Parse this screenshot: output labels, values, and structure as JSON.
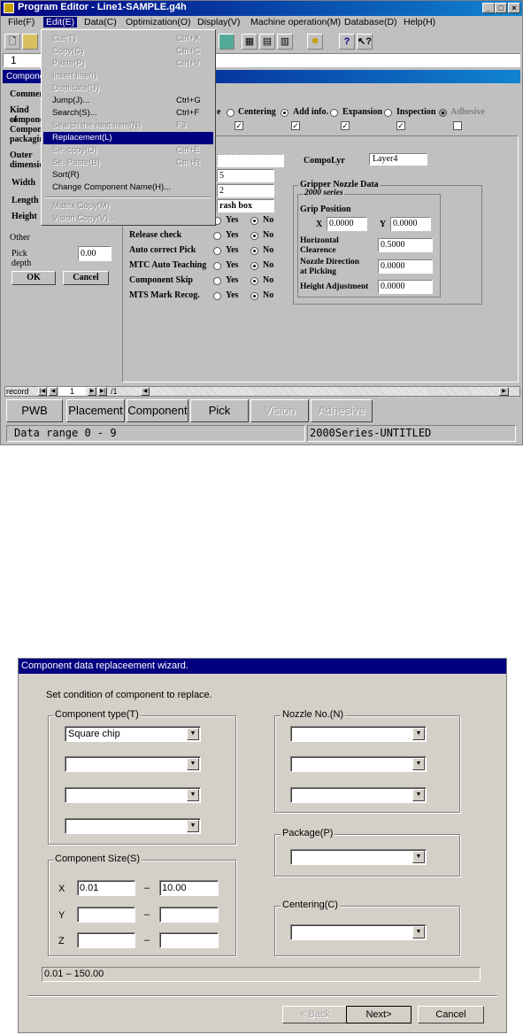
{
  "editor": {
    "title": "Program Editor - Line1-SAMPLE.g4h",
    "menu": [
      "File(F)",
      "Edit(E)",
      "Data(C)",
      "Optimization(O)",
      "Display(V)",
      "Machine operation(M)",
      "Database(D)",
      "Help(H)"
    ],
    "cell_value": "1",
    "panel_title": "Component",
    "edit_menu": [
      {
        "label": "Cut(T)",
        "shortcut": "Ctrl+X",
        "disabled": true
      },
      {
        "label": "Copy(C)",
        "shortcut": "Ctrl+C",
        "disabled": true
      },
      {
        "label": "Paste(P)",
        "shortcut": "Ctrl+V",
        "disabled": true
      },
      {
        "label": "Insert line(I)",
        "shortcut": "",
        "disabled": true
      },
      {
        "label": "Duplicate(U)",
        "shortcut": "",
        "disabled": true
      },
      {
        "label": "Jump(J)...",
        "shortcut": "Ctrl+G",
        "disabled": false
      },
      {
        "label": "Search(S)...",
        "shortcut": "Ctrl+F",
        "disabled": false
      },
      {
        "label": "Search the next item(N)",
        "shortcut": "F3",
        "disabled": true
      },
      {
        "label": "Replacement(L)",
        "shortcut": "",
        "disabled": false,
        "selected": true
      },
      {
        "label": "Se. copy(O)",
        "shortcut": "Ctrl+E",
        "disabled": true
      },
      {
        "label": "Se. Paste(B)",
        "shortcut": "Ctrl+R",
        "disabled": true
      },
      {
        "label": "Sort(R)",
        "shortcut": "",
        "disabled": false
      },
      {
        "label": "Change Component Name(H)...",
        "shortcut": "",
        "disabled": false
      },
      {
        "label": "Matrix Copy(M)",
        "shortcut": "",
        "disabled": true
      },
      {
        "label": "Vision Copy(V)...",
        "shortcut": "",
        "disabled": true
      }
    ],
    "left_labels": {
      "comment": "Commen",
      "kind1": "Kind of",
      "kind2": "compone",
      "kind3": "Compon",
      "kind4": "packagin",
      "outer1": "Outer",
      "outer2": "dimensio",
      "width": "Width",
      "length": "Length",
      "height": "Height",
      "other": "Other",
      "pick_depth": "Pick depth",
      "pick_depth_value": "0.00",
      "ok": "OK",
      "cancel": "Cancel"
    },
    "tabs_top": [
      "e",
      "Centering",
      "Add info.",
      "Expansion",
      "Inspection",
      "Adhesive"
    ],
    "fields": {
      "f1": "5",
      "f2": "2",
      "f3": "rash box"
    },
    "compo_lyr_label": "CompoLyr",
    "compo_lyr_value": "Layer4",
    "options": [
      {
        "label": "",
        "yes": "Yes",
        "no": "No"
      },
      {
        "label": "Release check",
        "yes": "Yes",
        "no": "No"
      },
      {
        "label": "Auto correct Pick",
        "yes": "Yes",
        "no": "No"
      },
      {
        "label": "MTC Auto Teaching",
        "yes": "Yes",
        "no": "No"
      },
      {
        "label": "Component Skip",
        "yes": "Yes",
        "no": "No"
      },
      {
        "label": "MTS Mark Recog.",
        "yes": "Yes",
        "no": "No"
      }
    ],
    "gripper": {
      "title": "Gripper Nozzle Data",
      "series": "2000 series",
      "grip_position": "Grip Position",
      "x_label": "X",
      "x_value": "0.0000",
      "y_label": "Y",
      "y_value": "0.0000",
      "horizontal_1": "Horizontal",
      "horizontal_2": "Clearence",
      "horizontal_value": "0.5000",
      "nozzle_dir_1": "Nozzle Direction",
      "nozzle_dir_2": "at Picking",
      "nozzle_dir_value": "0.0000",
      "height_adj": "Height Adjustment",
      "height_adj_value": "0.0000"
    },
    "record": {
      "label": "record",
      "value": "1",
      "total": "/1"
    },
    "bottom_tabs": [
      "PWB",
      "Placement",
      "Component",
      "Pick",
      "Vision",
      "Adhesive"
    ],
    "status_left": "Data range 0 - 9",
    "status_right": "2000Series-UNTITLED"
  },
  "wizard": {
    "title": "Component data replaceement wizard.",
    "instruction": "Set condition of component to replace.",
    "component_type_label": "Component type(T)",
    "component_type_values": [
      "Square chip",
      "",
      "",
      ""
    ],
    "component_size_label": "Component Size(S)",
    "size_rows": [
      {
        "axis": "X",
        "from": "0.01",
        "to": "10.00"
      },
      {
        "axis": "Y",
        "from": "",
        "to": ""
      },
      {
        "axis": "Z",
        "from": "",
        "to": ""
      }
    ],
    "dash": "–",
    "nozzle_label": "Nozzle No.(N)",
    "nozzle_values": [
      "",
      "",
      ""
    ],
    "package_label": "Package(P)",
    "package_value": "",
    "centering_label": "Centering(C)",
    "centering_value": "",
    "range_text": "0.01 – 150.00",
    "back": "< Back",
    "next": "Next>",
    "cancel": "Cancel"
  }
}
